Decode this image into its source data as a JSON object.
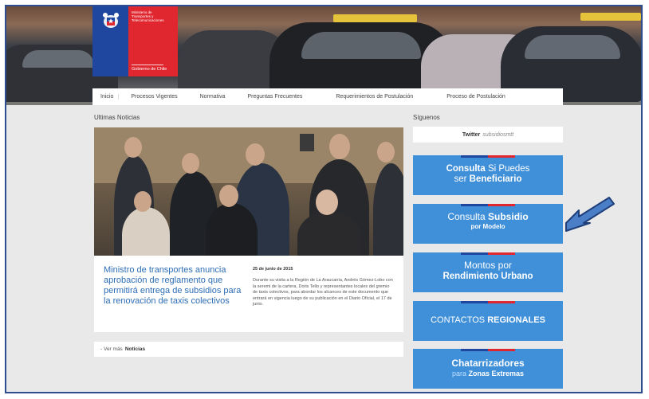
{
  "header": {
    "ministry_text": "Ministerio de\nTransportes y\nTelecomunicaciones",
    "government_text": "Gobierno de Chile",
    "brand_colors": {
      "blue": "#1f47a0",
      "red": "#e0262e"
    }
  },
  "nav": {
    "items": [
      {
        "label": "Inicio"
      },
      {
        "label": "Procesos Vigentes"
      },
      {
        "label": "Normativa"
      },
      {
        "label": "Preguntas Frecuentes"
      },
      {
        "label": "Requerimientos de Postulación"
      },
      {
        "label": "Proceso de Postulación"
      }
    ]
  },
  "news": {
    "section_title": "Ultimas Noticias",
    "headline": "Ministro de transportes anuncia aprobación de reglamento que permitirá entrega de subsidios para la renovación de taxis colectivos",
    "date": "25 de junio de 2015",
    "body": "Durante su visita a la Región de La Araucanía, Andrés Gómez-Lobo con la seremi de la cartera, Doris Tello y representantes locales del gremio de taxis colectivos, para abordar los alcances de este documento que entrará en vigencia luego de su publicación en el Diario Oficial, el 17 de junio.",
    "more_prefix": "- Ver más",
    "more_bold": "Noticias"
  },
  "sidebar": {
    "follow_title": "Síguenos",
    "twitter_label": "Twitter",
    "twitter_handle": "subsidiosmtt",
    "promos": [
      {
        "a": "Consulta",
        "b": " Si Puedes",
        "c": "ser ",
        "d": "Beneficiario"
      },
      {
        "a": "Consulta ",
        "b": "Subsidio",
        "c": "por Modelo"
      },
      {
        "a": "Montos por",
        "b": "Rendimiento Urbano"
      },
      {
        "a": "CONTACTOS ",
        "b": "REGIONALES"
      },
      {
        "a": "Chatarrizadores",
        "b": "para",
        "c": " Zonas Extremas"
      }
    ],
    "promo_color": "#3f8fd9",
    "arrow_color": "#4a7fc8"
  }
}
